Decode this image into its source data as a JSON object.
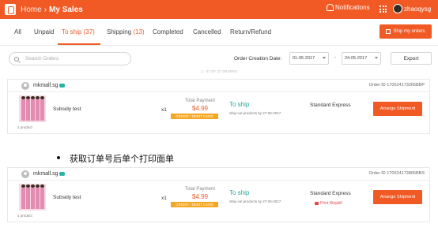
{
  "header": {
    "home_label": "Home",
    "separator": "›",
    "current_page": "My Sales",
    "notifications_label": "Notifications",
    "username": "zhaoqysg",
    "brand_color": "#f15a25"
  },
  "tabs": [
    {
      "label": "All",
      "count": ""
    },
    {
      "label": "Unpaid",
      "count": ""
    },
    {
      "label": "To ship",
      "count": "(37)"
    },
    {
      "label": "Shipping",
      "count": "(13)"
    },
    {
      "label": "Completed",
      "count": ""
    },
    {
      "label": "Cancelled",
      "count": ""
    },
    {
      "label": "Return/Refund",
      "count": ""
    }
  ],
  "active_tab": "To ship",
  "ship_my_orders_label": "Ship my orders",
  "filters": {
    "search_placeholder": "Search Orders",
    "date_label": "Order Creation Date:",
    "date_from": "01-05-2017",
    "date_separator": "-",
    "date_to": "24-05-2017",
    "export_label": "Export"
  },
  "orders_summary": "1 - 37 OF 37 ORDERS",
  "orders": [
    {
      "buyer": "mkmall.sg",
      "order_id": "Order ID 170524173265BBP",
      "product_name": "Subsidy test",
      "product_count": "1 product",
      "quantity": "x1",
      "total_label": "Total Payment",
      "price": "$4.99",
      "payment_method": "CREDIT / DEBIT CARD",
      "status": "To ship",
      "status_note": "Ship out products by 27-05-2017",
      "logistics": "Standard Express",
      "waybill": "",
      "action_label": "Arrange Shipment"
    },
    {
      "buyer": "mkmall.sg",
      "order_id": "Order ID 170524173865BBS",
      "product_name": "Subsidy test",
      "product_count": "1 product",
      "quantity": "x1",
      "total_label": "Total Payment",
      "price": "$4.99",
      "payment_method": "CREDIT / DEBIT CARD",
      "status": "To ship",
      "status_note": "Ship out products by 27-05-2017",
      "logistics": "Standard Express",
      "waybill": "Print Waybill",
      "action_label": "Arrange Shipment"
    }
  ],
  "caption": "获取订单号后单个打印面单"
}
